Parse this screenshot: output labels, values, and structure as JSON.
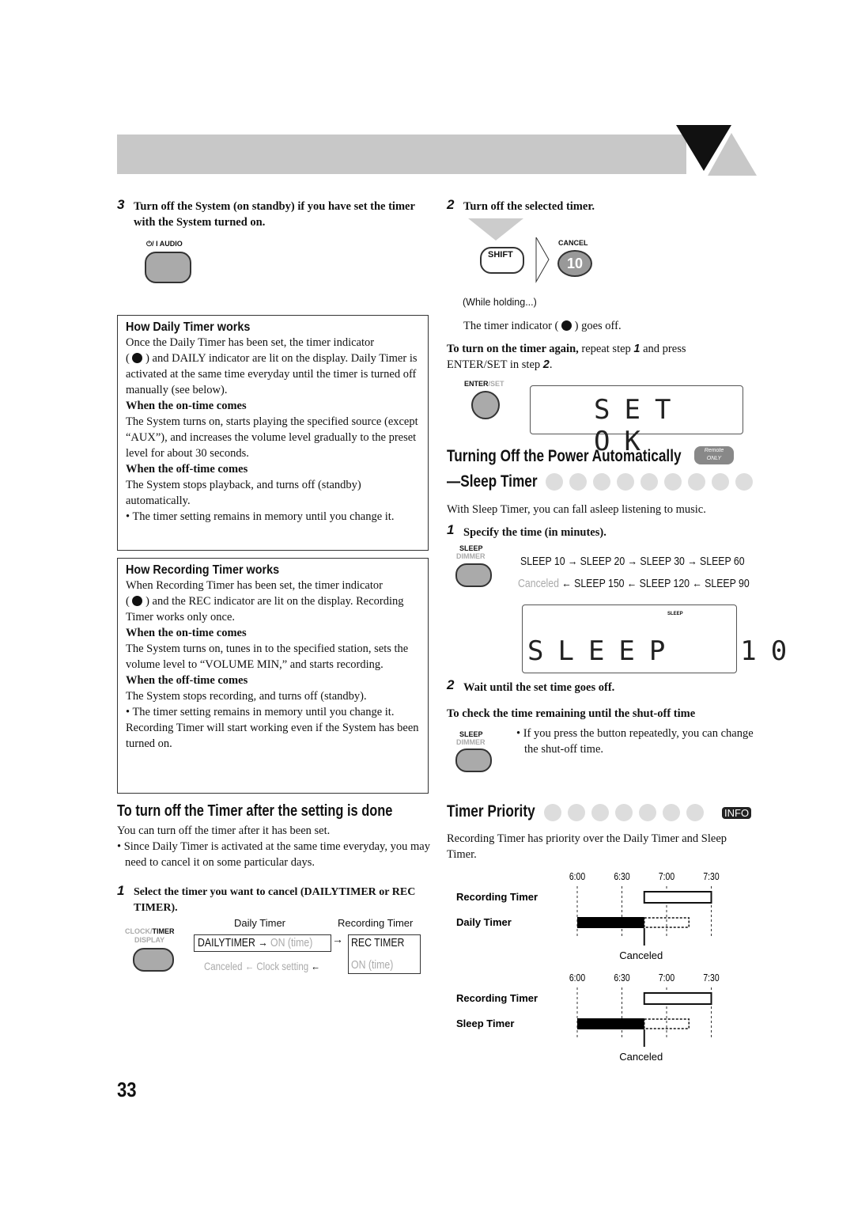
{
  "page_number": "33",
  "left": {
    "step3": {
      "num": "3",
      "text": "Turn off the System (on standby) if you have set the timer with the System turned on.",
      "button_label": "⏻/ I AUDIO"
    },
    "daily_box": {
      "title": "How Daily Timer works",
      "p1a": "Once the Daily Timer has been set, the timer indicator",
      "p1b": ") and DAILY indicator are lit on the display. Daily Timer is activated at the same time everyday until the timer is turned off manually (see below).",
      "on_head": "When the on-time comes",
      "on_text": "The System turns on, starts playing the specified source (except “AUX”), and increases the volume level gradually to the preset level for about 30 seconds.",
      "off_head": "When the off-time comes",
      "off_text": "The System stops playback, and turns off (standby) automatically.",
      "bullet": "• The timer setting remains in memory until you change it."
    },
    "rec_box": {
      "title": "How Recording Timer works",
      "p1a": "When Recording Timer has been set, the timer indicator",
      "p1b": ") and the REC indicator are lit on the display. Recording Timer works only once.",
      "on_head": "When the on-time comes",
      "on_text": "The System turns on, tunes in to the specified station, sets the volume level to “VOLUME MIN,” and starts recording.",
      "off_head": "When the off-time comes",
      "off_text": "The System stops recording, and turns off (standby).",
      "bullet": "• The timer setting remains in memory until you change it.",
      "note": "Recording Timer will start working even if the System has been turned on."
    },
    "turnoff": {
      "heading": "To turn off the Timer after the setting is done",
      "p1": "You can turn off the timer after it has been set.",
      "bullet": "• Since Daily Timer is activated at the same time everyday, you may need to cancel it on some particular days.",
      "step1_num": "1",
      "step1": "Select the timer you want to cancel (DAILYTIMER or REC TIMER).",
      "btn_label1": "CLOCK/",
      "btn_label2": "TIMER",
      "btn_label3": "DISPLAY",
      "col_daily": "Daily Timer",
      "col_rec": "Recording Timer",
      "dailytimer": "DAILYTIMER",
      "on_time": "ON (time)",
      "rec_timer": "REC TIMER",
      "canceled": "Canceled",
      "clock_setting": "Clock setting"
    }
  },
  "right": {
    "step2": {
      "num": "2",
      "text": "Turn off the selected timer.",
      "shift": "SHIFT",
      "cancel": "CANCEL",
      "ten": "10",
      "while": "(While holding...)",
      "goes_off_a": "The timer indicator (",
      "goes_off_b": ") goes off.",
      "again_b": "To turn on the timer again,",
      "again_r": " repeat step ",
      "again_n": "1",
      "again_r2": " and press ENTER/SET in step ",
      "again_n2": "2",
      "again_end": ".",
      "enter": "ENTER",
      "set": "/SET",
      "lcd": "SET OK"
    },
    "sleep": {
      "heading1": "Turning Off the Power Automatically",
      "remote1": "Remote",
      "remote2": "ONLY",
      "heading2": "—Sleep Timer",
      "intro": "With Sleep Timer, you can fall asleep listening to music.",
      "step1_num": "1",
      "step1": "Specify the time (in minutes).",
      "btn1": "SLEEP",
      "btn2": "DIMMER",
      "seq_top": [
        "SLEEP 10",
        "SLEEP 20",
        "SLEEP 30",
        "SLEEP 60"
      ],
      "seq_bottom": [
        "Canceled",
        "SLEEP 150",
        "SLEEP 120",
        "SLEEP 90"
      ],
      "lcd": "SLEEP  10",
      "lcd_icon": "SLEEP",
      "step2_num": "2",
      "step2": "Wait until the set time goes off.",
      "check_head": "To check the time remaining until the shut-off time",
      "check_text": "• If you press the button repeatedly, you can change the shut-off time."
    },
    "priority": {
      "heading": "Timer Priority",
      "info": "INFO",
      "text": "Recording Timer has priority over the Daily Timer and Sleep Timer."
    }
  },
  "chart_data": [
    {
      "type": "timeline",
      "ticks": [
        "6:00",
        "6:30",
        "7:00",
        "7:30"
      ],
      "rows": [
        {
          "name": "Recording Timer",
          "start": "6:45",
          "end": "7:30",
          "style": "outline"
        },
        {
          "name": "Daily Timer",
          "start": "6:00",
          "end": "6:45",
          "style": "filled",
          "canceled_until": "7:15"
        }
      ],
      "annotation": "Canceled"
    },
    {
      "type": "timeline",
      "ticks": [
        "6:00",
        "6:30",
        "7:00",
        "7:30"
      ],
      "rows": [
        {
          "name": "Recording Timer",
          "start": "6:45",
          "end": "7:30",
          "style": "outline"
        },
        {
          "name": "Sleep Timer",
          "start": "6:00",
          "end": "6:45",
          "style": "filled",
          "canceled_until": "7:15"
        }
      ],
      "annotation": "Canceled"
    }
  ]
}
